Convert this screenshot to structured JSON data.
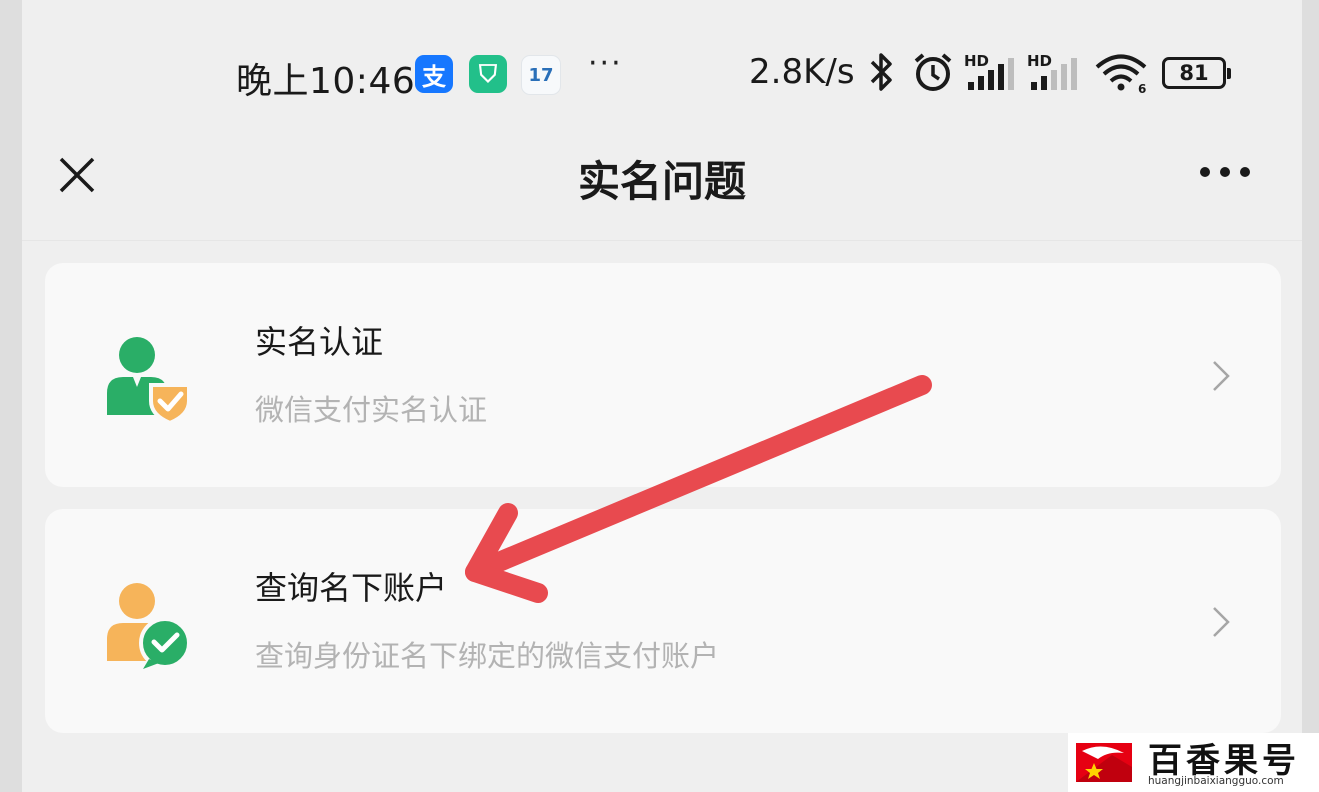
{
  "status_bar": {
    "time": "晚上10:46",
    "app_icons": [
      {
        "name": "alipay-icon",
        "glyph": "支",
        "color": "#1677ff"
      },
      {
        "name": "shield-app-icon",
        "glyph": "⛉",
        "color": "#22c08a"
      },
      {
        "name": "calendar-icon",
        "glyph": "17",
        "color": "#2a6fb8"
      }
    ],
    "more": "···",
    "network_speed": "2.8K/s",
    "signal_labels": [
      "HD",
      "HD"
    ],
    "wifi_sub": "6",
    "battery": "81"
  },
  "nav": {
    "title": "实名问题",
    "close_icon": "close-icon",
    "more_icon": "more-icon"
  },
  "menu": [
    {
      "title": "实名认证",
      "subtitle": "微信支付实名认证",
      "icon": "user-shield-icon",
      "icon_colors": {
        "person": "#2aae67",
        "badge": "#f6b45a"
      }
    },
    {
      "title": "查询名下账户",
      "subtitle": "查询身份证名下绑定的微信支付账户",
      "icon": "user-wechat-pay-icon",
      "icon_colors": {
        "person": "#f6b45a",
        "badge": "#2aae67"
      }
    }
  ],
  "annotation": {
    "color": "#e84a4f"
  },
  "watermark": {
    "name": "百香果号",
    "url": "huangjinbaixiangguo.com",
    "logo_colors": [
      "#e60012",
      "#ffd400"
    ]
  }
}
